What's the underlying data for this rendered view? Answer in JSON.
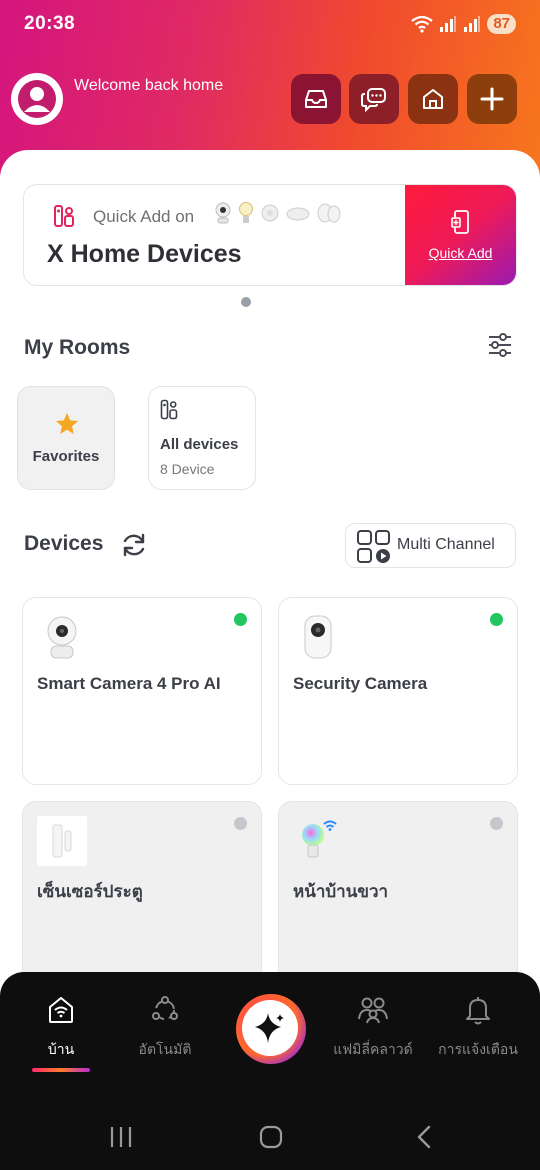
{
  "status_bar": {
    "time": "20:38",
    "battery": "87"
  },
  "header": {
    "welcome": "Welcome back home",
    "buttons": [
      "inbox-icon",
      "chat-icon",
      "home-icon",
      "plus-icon"
    ]
  },
  "quick_add": {
    "small_text": "Quick Add on",
    "title": "X Home Devices",
    "button_label": "Quick Add"
  },
  "rooms": {
    "title": "My Rooms",
    "favorites_label": "Favorites",
    "all_label": "All devices",
    "all_count": "8 Device"
  },
  "devices_section": {
    "title": "Devices",
    "multi_channel_label": "Multi Channel"
  },
  "devices": [
    {
      "name": "Smart Camera 4 Pro AI",
      "status": "online",
      "status_color": "#22c55e"
    },
    {
      "name": "Security Camera",
      "status": "online",
      "status_color": "#22c55e"
    },
    {
      "name": "เซ็นเซอร์ประตู",
      "status": "offline",
      "status_color": "#c4c8cc"
    },
    {
      "name": "หน้าบ้านขวา",
      "status": "offline",
      "status_color": "#c4c8cc"
    }
  ],
  "nav": {
    "home": "บ้าน",
    "automation": "อัตโนมัติ",
    "family": "แฟมิลี่คลาวด์",
    "notifications": "การแจ้งเตือน"
  },
  "colors": {
    "brand_gradient_start": "#d4157e",
    "brand_gradient_end": "#f7771d",
    "online": "#22c55e",
    "star": "#f5a623"
  }
}
